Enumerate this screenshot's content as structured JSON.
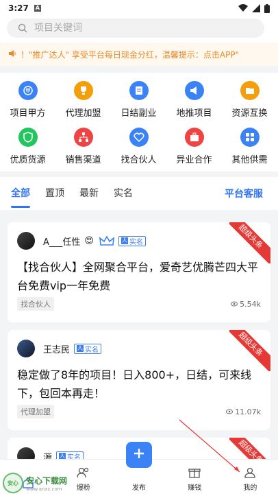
{
  "status": {
    "time": "3:27",
    "app_badge": "A"
  },
  "search": {
    "placeholder": "项目关键词"
  },
  "notice": {
    "text": "！\"推广达人\" 享受平台每日现金分红，温馨提示：点击APP\""
  },
  "grid": {
    "row1": [
      {
        "label": "项目甲方",
        "icon": "badge-icon",
        "color": "#3b82f6"
      },
      {
        "label": "代理加盟",
        "icon": "trophy-icon",
        "color": "#f59e0b"
      },
      {
        "label": "日结副业",
        "icon": "document-icon",
        "color": "#3b82f6"
      },
      {
        "label": "地推项目",
        "icon": "megaphone-icon",
        "color": "#3b82f6"
      },
      {
        "label": "资源互换",
        "icon": "folder-icon",
        "color": "#f59e0b"
      }
    ],
    "row2": [
      {
        "label": "优质货源",
        "icon": "shield-icon",
        "color": "#22c55e"
      },
      {
        "label": "销售渠道",
        "icon": "network-icon",
        "color": "#ef4444"
      },
      {
        "label": "找合伙人",
        "icon": "heart-icon",
        "color": "#3b82f6"
      },
      {
        "label": "异业合作",
        "icon": "briefcase-icon",
        "color": "#ef4444"
      },
      {
        "label": "其他供需",
        "icon": "grid-icon",
        "color": "#3b82f6"
      }
    ]
  },
  "tabs": {
    "items": [
      "全部",
      "置顶",
      "最新",
      "实名"
    ],
    "active": "全部",
    "service": "平台客服"
  },
  "posts": [
    {
      "author": "A___任性",
      "verified": "实名",
      "title": "【找合伙人】全网聚合平台，爱奇艺优腾芒四大平台免费vip一年免费",
      "tag": "找合伙人",
      "views": "5.54k",
      "ribbon": "超级头条"
    },
    {
      "author": "王志民",
      "verified": "实名",
      "title": "稳定做了8年的项目！日入800+，日结，可来线下，包回本再走！",
      "tag": "代理加盟",
      "views": "11.07k",
      "ribbon": "超级头条"
    },
    {
      "author": "源",
      "verified": "实名",
      "ribbon": "超级头条"
    }
  ],
  "nav": {
    "items": [
      "爆粉",
      "发布",
      "赚钱",
      "我的"
    ]
  },
  "watermark": {
    "name": "安心下载网",
    "url": "www.anxz.com"
  },
  "colors": {
    "accent": "#3275f4",
    "ribbon": "#e53935",
    "notice": "#e78a2a"
  }
}
